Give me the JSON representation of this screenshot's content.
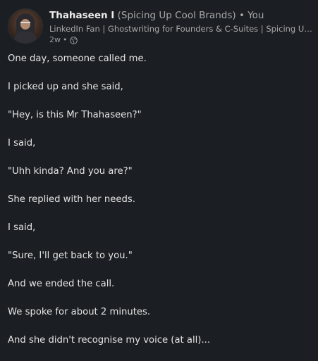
{
  "author": {
    "name": "Thahaseen I",
    "tagline": "(Spicing Up Cool Brands)",
    "separator": "•",
    "relation": "You",
    "headline": "LinkedIn Fan | Ghostwriting for Founders & C-Suites | Spicing Up Co...",
    "time": "2w",
    "time_separator": "•",
    "visibility_icon": "globe-icon"
  },
  "post": {
    "lines": [
      "One day, someone called me.",
      "I picked up and she said,",
      "\"Hey, is this Mr Thahaseen?\"",
      "I said,",
      "\"Uhh kinda? And you are?\"",
      "She replied with her needs.",
      "I said,",
      "\"Sure, I'll get back to you.\"",
      "And we ended the call.",
      "We spoke for about 2 minutes.",
      "And she didn't recognise my voice (at all)..."
    ]
  },
  "colors": {
    "background": "#1b1f23",
    "text_primary": "#e4e4e4",
    "text_secondary": "#a8a8a8"
  }
}
